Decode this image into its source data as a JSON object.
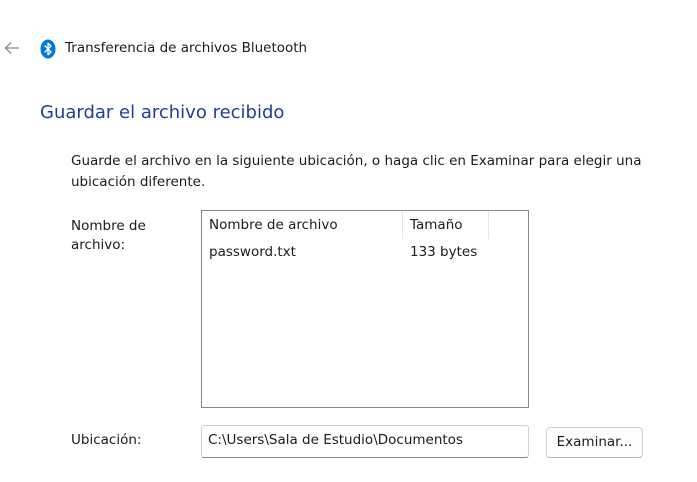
{
  "header": {
    "title": "Transferencia de archivos Bluetooth",
    "back_icon": "arrow-left-icon",
    "app_icon": "bluetooth-icon",
    "accent_color": "#0078d4"
  },
  "page": {
    "heading": "Guardar el archivo recibido",
    "heading_color": "#1e3f93",
    "instructions": "Guarde el archivo en la siguiente ubicación, o haga clic en Examinar para elegir una ubicación diferente."
  },
  "file_list": {
    "label": "Nombre de archivo:",
    "columns": [
      "Nombre de archivo",
      "Tamaño"
    ],
    "rows": [
      {
        "name": "password.txt",
        "size": "133 bytes"
      }
    ]
  },
  "location": {
    "label": "Ubicación:",
    "value": "C:\\Users\\Sala de Estudio\\Documentos",
    "browse_label": "Examinar..."
  }
}
